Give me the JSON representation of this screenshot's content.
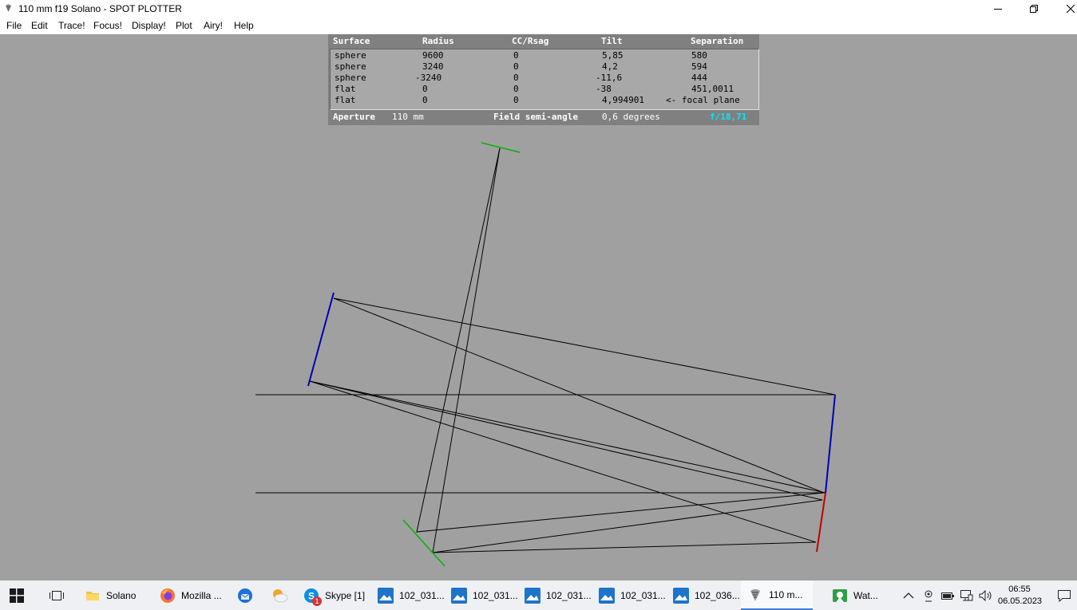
{
  "window": {
    "title": "110 mm f19 Solano - SPOT PLOTTER"
  },
  "menu": [
    "File",
    "Edit",
    "Trace!",
    "Focus!",
    "Display!",
    "Plot",
    "Airy!",
    "Help"
  ],
  "table": {
    "headers": [
      "Surface",
      "Radius",
      "CC/Rsag",
      "Tilt",
      "Separation"
    ],
    "rows": [
      [
        "sphere",
        "9600",
        "0",
        "5,85",
        "580"
      ],
      [
        "sphere",
        "3240",
        "0",
        "4,2",
        "594"
      ],
      [
        "sphere",
        "-3240",
        "0",
        "-11,6",
        "444"
      ],
      [
        "flat",
        "0",
        "0",
        "-38",
        "451,0011"
      ],
      [
        "flat",
        "0",
        "0",
        "4,994901",
        "<- focal plane"
      ]
    ],
    "footer": {
      "aperture_label": "Aperture",
      "aperture_value": "110 mm",
      "field_label": "Field semi-angle",
      "field_value": "0,6 degrees",
      "fnumber": "f/18,71"
    }
  },
  "taskbar": {
    "items": [
      {
        "label": "Solano",
        "icon": "folder-icon"
      },
      {
        "label": "Mozilla ...",
        "icon": "firefox-icon"
      },
      {
        "label": "",
        "icon": "thunderbird-icon"
      },
      {
        "label": "",
        "icon": "weather-icon"
      },
      {
        "label": "Skype [1]",
        "icon": "skype-icon",
        "badge": "1"
      },
      {
        "label": "102_031...",
        "icon": "photo-icon"
      },
      {
        "label": "102_031...",
        "icon": "photo-icon"
      },
      {
        "label": "102_031...",
        "icon": "photo-icon"
      },
      {
        "label": "102_031...",
        "icon": "photo-icon"
      },
      {
        "label": "102_036...",
        "icon": "photo-icon"
      },
      {
        "label": "110 m...",
        "icon": "spot-plotter-icon",
        "active": true
      },
      {
        "label": "Wat...",
        "icon": "watch-icon"
      }
    ],
    "clock": {
      "time": "06:55",
      "date": "06.05.2023"
    }
  },
  "colors": {
    "background": "#a0a0a0",
    "ray": "#000000",
    "mirror_blue": "#0000b4",
    "mirror_red": "#c00000",
    "mirror_green": "#00b400",
    "fnumber": "#00e5ff"
  }
}
